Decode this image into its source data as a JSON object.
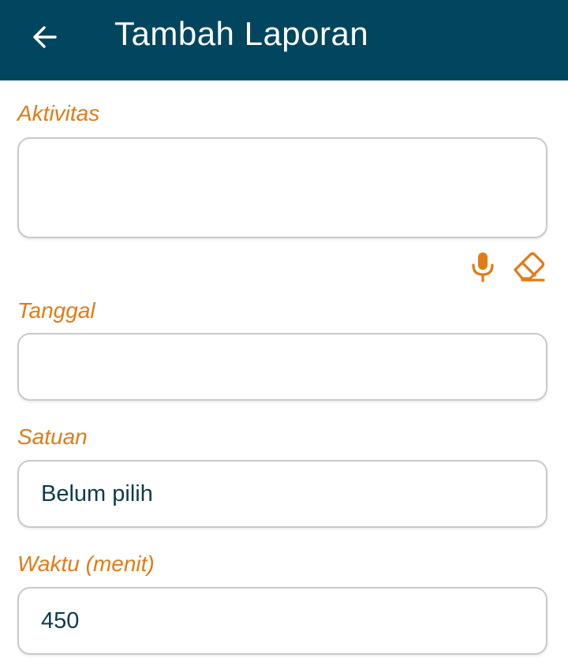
{
  "appbar": {
    "title": "Tambah Laporan",
    "back_icon": "arrow-left-icon",
    "background": "#02455e"
  },
  "accent_color": "#e07b16",
  "form": {
    "aktivitas": {
      "label": "Aktivitas",
      "value": "",
      "icons": [
        "microphone-icon",
        "eraser-icon"
      ]
    },
    "tanggal": {
      "label": "Tanggal",
      "value": ""
    },
    "satuan": {
      "label": "Satuan",
      "value": "Belum pilih"
    },
    "waktu": {
      "label": "Waktu (menit)",
      "value": "450"
    }
  }
}
